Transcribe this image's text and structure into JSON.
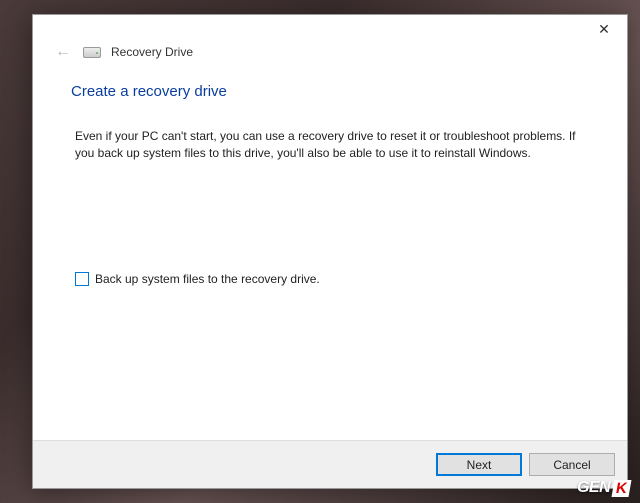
{
  "wizard": {
    "title": "Recovery Drive",
    "close_symbol": "✕",
    "back_symbol": "←"
  },
  "page": {
    "heading": "Create a recovery drive",
    "description": "Even if your PC can't start, you can use a recovery drive to reset it or troubleshoot problems. If you back up system files to this drive, you'll also be able to use it to reinstall Windows."
  },
  "checkbox": {
    "label": "Back up system files to the recovery drive.",
    "checked": false
  },
  "buttons": {
    "next": "Next",
    "cancel": "Cancel"
  },
  "watermark": {
    "text": "GEN",
    "accent": "K"
  }
}
